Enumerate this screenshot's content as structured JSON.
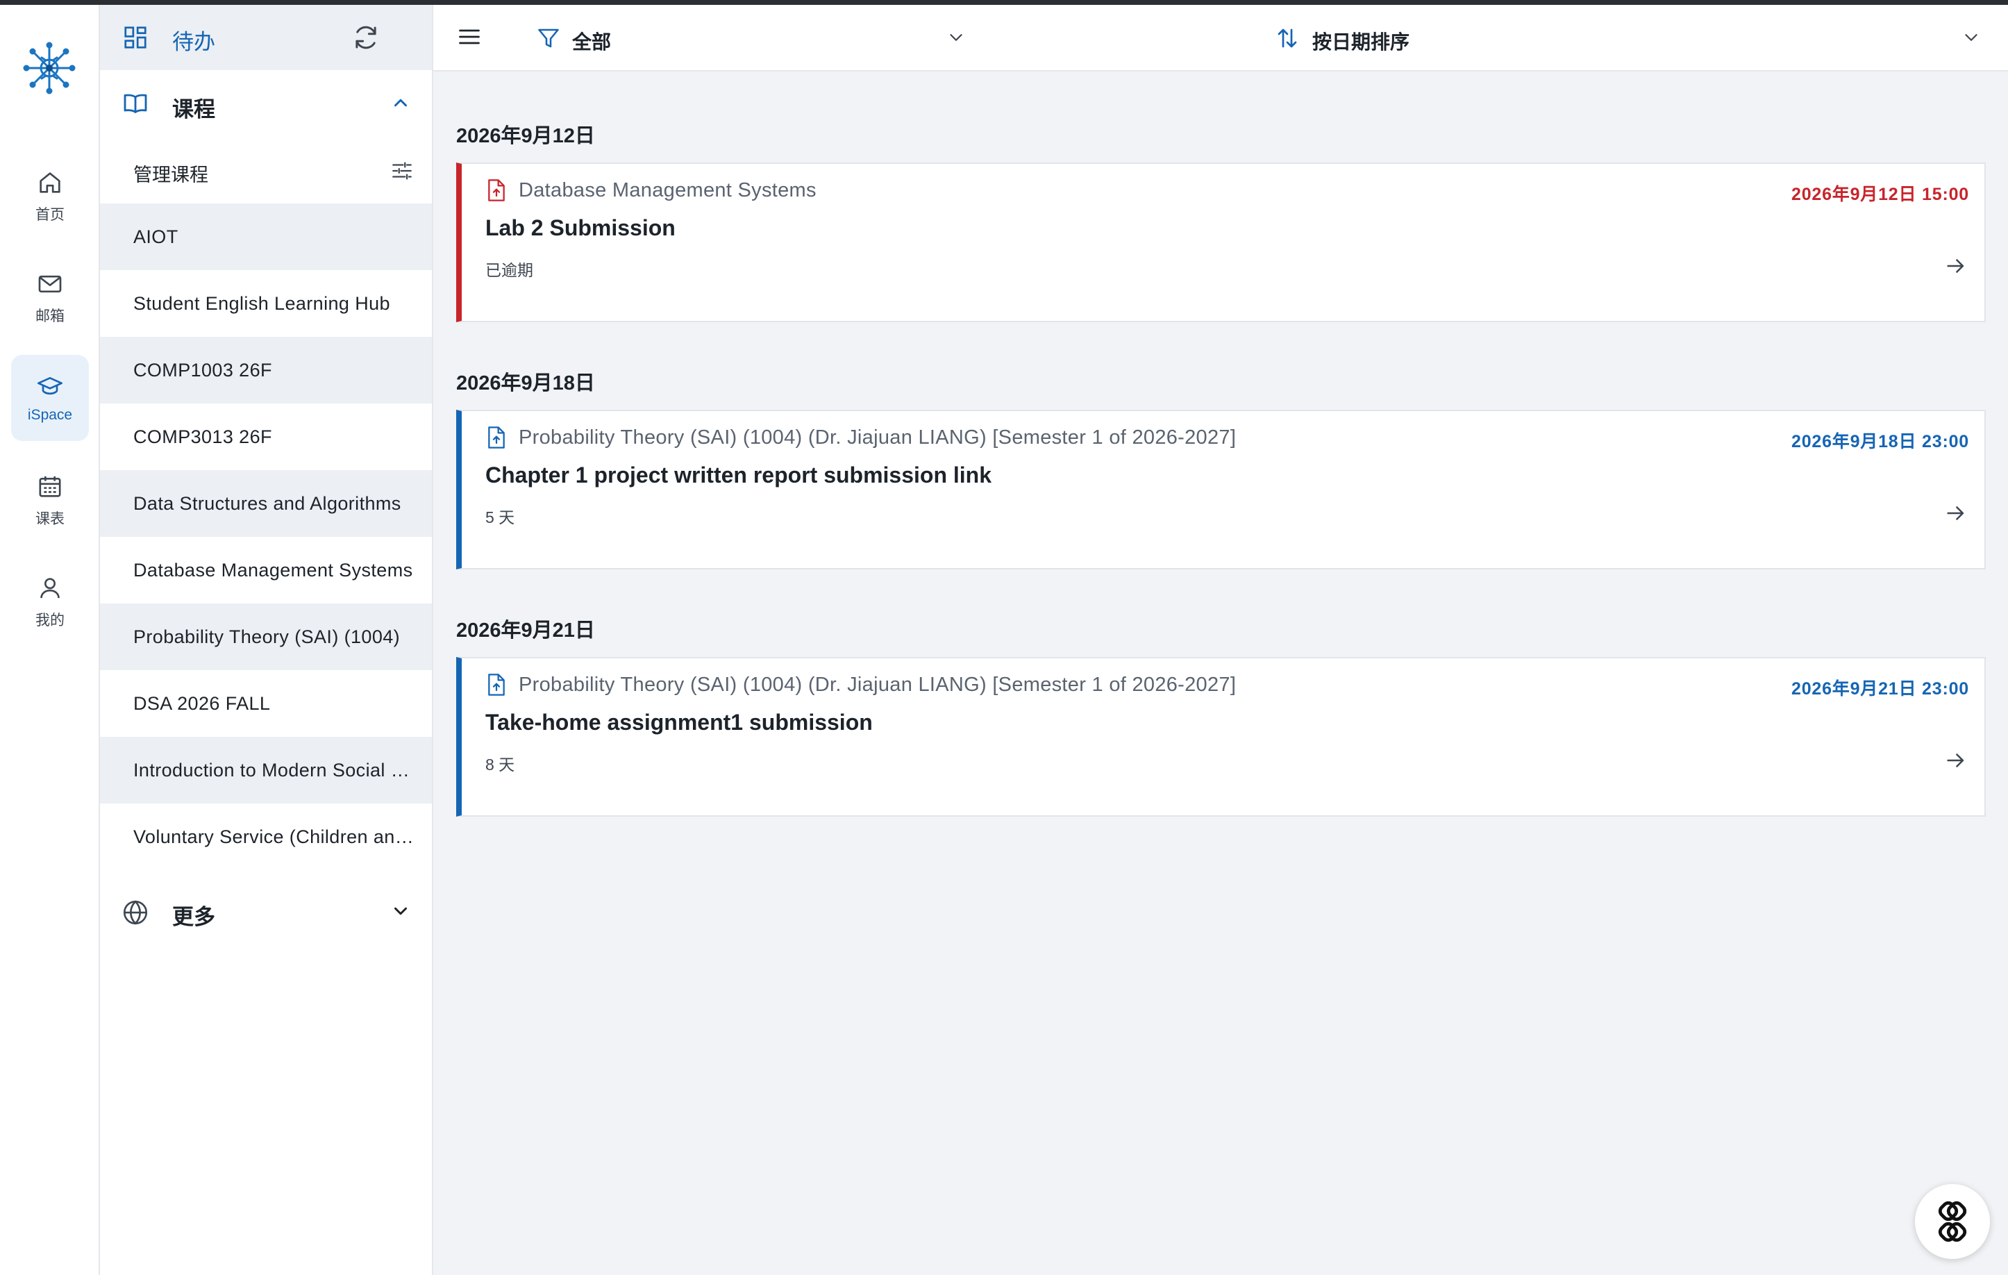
{
  "rail": {
    "items": [
      {
        "label": "首页",
        "icon": "home-icon"
      },
      {
        "label": "邮箱",
        "icon": "mail-icon"
      },
      {
        "label": "iSpace",
        "icon": "graduation-cap-icon",
        "active": true
      },
      {
        "label": "课表",
        "icon": "calendar-icon"
      },
      {
        "label": "我的",
        "icon": "user-icon"
      }
    ]
  },
  "sidebar": {
    "todo_label": "待办",
    "courses_label": "课程",
    "manage_label": "管理课程",
    "more_label": "更多",
    "courses": [
      "AIOT",
      "Student English Learning Hub",
      "COMP1003 26F",
      "COMP3013 26F",
      "Data Structures and Algorithms",
      "Database Management Systems",
      "Probability Theory (SAI) (1004)",
      "DSA 2026 FALL",
      "Introduction to Modern Social Sciences",
      "Voluntary Service (Children and Youth)"
    ]
  },
  "toolbar": {
    "filter_label": "全部",
    "sort_label": "按日期排序"
  },
  "groups": [
    {
      "date": "2026年9月12日",
      "items": [
        {
          "course": "Database Management Systems",
          "title": "Lab 2 Submission",
          "due": "2026年9月12日 15:00",
          "status": "已逾期",
          "overdue": true
        }
      ]
    },
    {
      "date": "2026年9月18日",
      "items": [
        {
          "course": "Probability Theory (SAI) (1004) (Dr. Jiajuan LIANG) [Semester 1 of 2026-2027]",
          "title": "Chapter 1 project written report submission link",
          "due": "2026年9月18日 23:00",
          "status": "5 天",
          "overdue": false
        }
      ]
    },
    {
      "date": "2026年9月21日",
      "items": [
        {
          "course": "Probability Theory (SAI) (1004) (Dr. Jiajuan LIANG) [Semester 1 of 2026-2027]",
          "title": "Take-home assignment1 submission",
          "due": "2026年9月21日 23:00",
          "status": "8 天",
          "overdue": false
        }
      ]
    }
  ],
  "colors": {
    "accent": "#1565b4",
    "overdue": "#c8242b"
  }
}
